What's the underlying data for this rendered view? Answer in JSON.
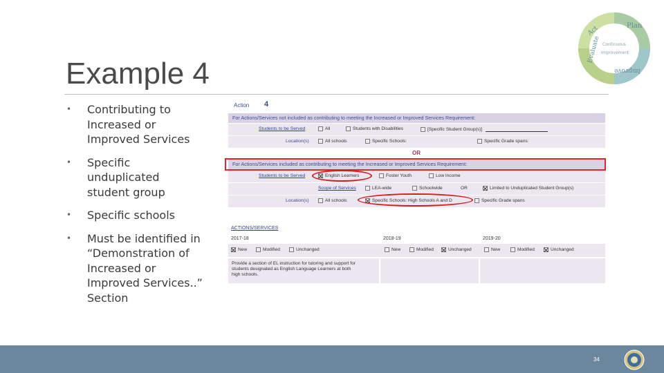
{
  "slide": {
    "title": "Example 4",
    "page_number": "34"
  },
  "cycle_graphic": {
    "words": [
      "Plan",
      "Improve",
      "Evaluate",
      "Act",
      "Continuous",
      "Improvement"
    ]
  },
  "bullets": [
    "Contributing to\nIncreased or\nImproved Services",
    "Specific\nunduplicated\nstudent group",
    "Specific schools",
    "Must be identified in\n“Demonstration of\nIncreased or\nImproved Services..”\nSection"
  ],
  "form": {
    "action_label": "Action",
    "action_number": "4",
    "section1": {
      "header": "For Actions/Services not included as contributing to meeting the Increased or Improved Services Requirement:",
      "students_label": "Students to be Served",
      "students_options": [
        "All",
        "Students with Disabilities",
        "[Specific Student Group(s)]"
      ],
      "location_label": "Location(s)",
      "location_options": [
        "All schools",
        "Specific Schools:",
        "Specific Grade spans:"
      ]
    },
    "or_text": "OR",
    "section2": {
      "header": "For Actions/Services included as contributing to meeting the Increased or Improved Services Requirement:",
      "students_label": "Students to be Served",
      "students_options": [
        "English Learners",
        "Foster Youth",
        "Low Income"
      ],
      "scope_label": "Scope of Services",
      "scope_options": [
        "LEA-wide",
        "Schoolwide",
        "Limited to Unduplicated Student Group(s)"
      ],
      "scope_or": "OR",
      "location_label": "Location(s)",
      "location_options": [
        "All schools",
        "Specific Schools: High Schools A and D",
        "Specific Grade spans"
      ]
    },
    "actions": {
      "heading": "ACTIONS/SERVICES",
      "years": [
        "2017-18",
        "2018-19",
        "2019-20"
      ],
      "status_options": [
        "New",
        "Modified",
        "Unchanged"
      ],
      "description": "Provide a section of EL instruction for tutoring and support for\nstudents designated as English Language Learners at both\nhigh schools."
    }
  }
}
